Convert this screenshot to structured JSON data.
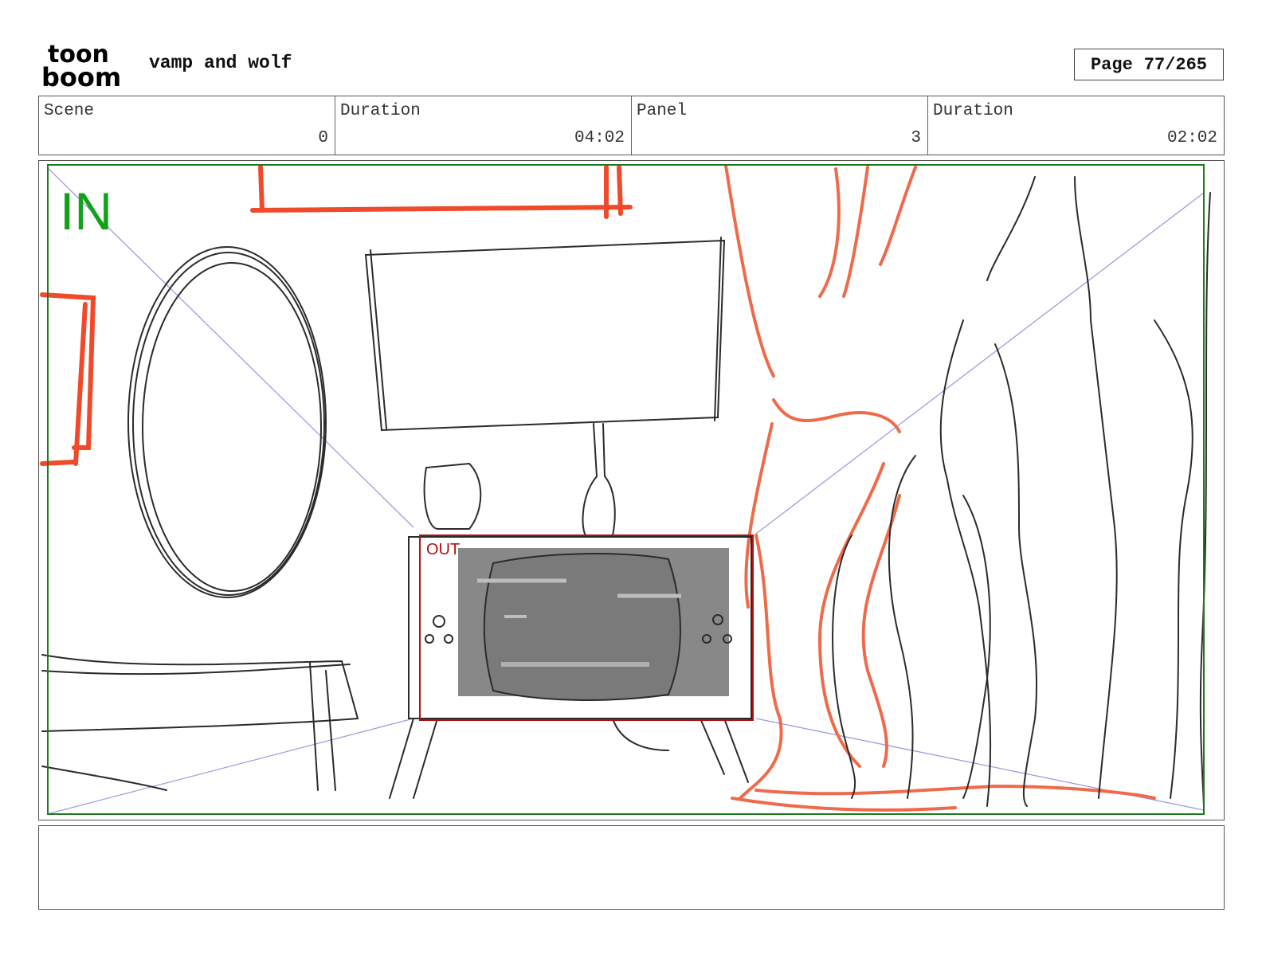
{
  "header": {
    "logo_top": "toon",
    "logo_bottom": "boom",
    "project_title": "vamp and wolf",
    "page_label": "Page",
    "page_value": "77/265"
  },
  "info": {
    "scene_label": "Scene",
    "scene_value": "0",
    "scene_duration_label": "Duration",
    "scene_duration_value": "04:02",
    "panel_label": "Panel",
    "panel_value": "3",
    "panel_duration_label": "Duration",
    "panel_duration_value": "02:02"
  },
  "panel": {
    "in_label": "IN",
    "out_label": "OUT"
  },
  "colors": {
    "in_frame": "#1e7a1e",
    "out_frame": "#b01010",
    "sketch_red": "#ef4a2a",
    "sketch_dark": "#2b2b2b",
    "guide_lines": "#9a9ee0"
  },
  "caption": ""
}
